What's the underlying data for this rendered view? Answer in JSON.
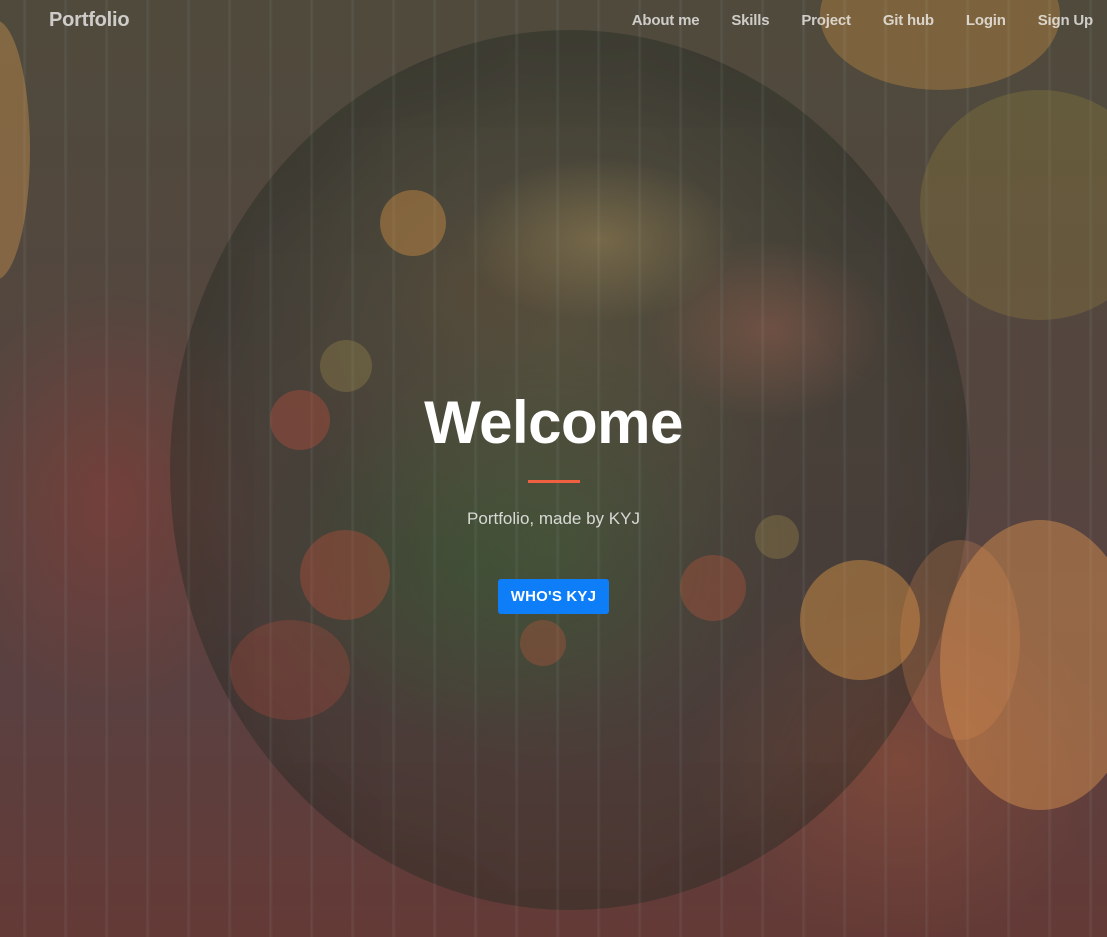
{
  "navbar": {
    "brand": "Portfolio",
    "links": [
      {
        "label": "About me"
      },
      {
        "label": "Skills"
      },
      {
        "label": "Project"
      },
      {
        "label": "Git hub"
      },
      {
        "label": "Login"
      },
      {
        "label": "Sign Up"
      }
    ]
  },
  "hero": {
    "title": "Welcome",
    "subtitle": "Portfolio, made by KYJ",
    "cta_label": "WHO'S KYJ"
  },
  "colors": {
    "divider": "#f05f40",
    "cta_button": "#0d7ef8",
    "heading_text": "#ffffff"
  }
}
